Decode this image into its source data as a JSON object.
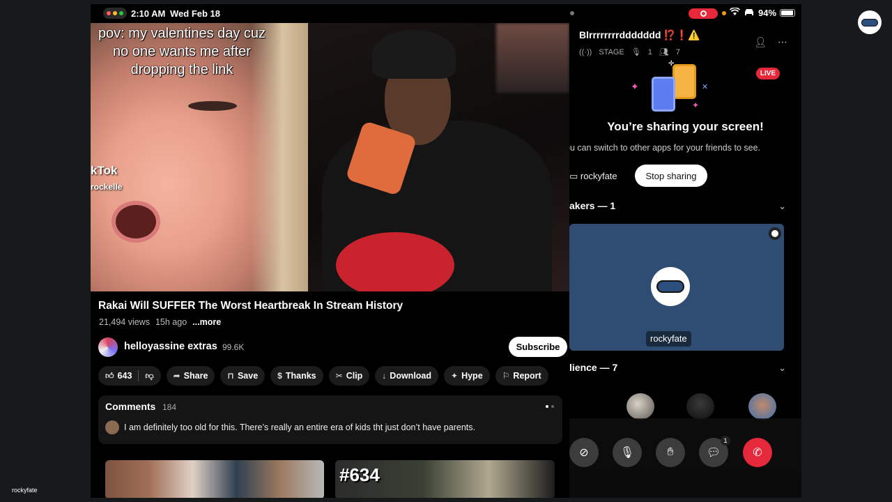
{
  "status_bar": {
    "time": "2:10 AM",
    "date": "Wed Feb 18",
    "battery": "94%",
    "dot_colors": [
      "#ff5f57",
      "#febc2e",
      "#28c840"
    ]
  },
  "video": {
    "overlay_caption": "pov: my valentines day cuz no one wants me after dropping the link",
    "tiktok_label": "kTok",
    "tiktok_user": "rockelle",
    "title": "Rakai Will SUFFER The Worst Heartbreak In Stream History",
    "views": "21,494 views",
    "age": "15h ago",
    "more": "...more"
  },
  "channel": {
    "name": "helloyassine extras",
    "subscribers": "99.6K",
    "subscribe_label": "Subscribe"
  },
  "actions": {
    "likes": "643",
    "share": "Share",
    "save": "Save",
    "thanks": "Thanks",
    "clip": "Clip",
    "download": "Download",
    "hype": "Hype",
    "report": "Report"
  },
  "comments": {
    "heading": "Comments",
    "count": "184",
    "top_comment": "I am definitely too old for this. There’s really an entire era of kids tht just don’t have parents."
  },
  "thumbnails": {
    "second_label": "#634"
  },
  "discord": {
    "title": "Blrrrrrrrrddddddd ⁉️❗⚠️",
    "stage_label": "STAGE",
    "speaker_count": "1",
    "listener_count": "7",
    "live_label": "LIVE",
    "share_title": "You’re sharing your screen!",
    "share_subtitle": "ou can switch to other apps for your friends to see.",
    "share_user": "rockyfate",
    "stop_label": "Stop sharing",
    "speakers_section": "akers — 1",
    "speaker_name": "rockyfate",
    "audience_section": "lience — 7",
    "chat_badge": "1",
    "accent_color": "#e5283a"
  },
  "footer": {
    "username": "rockyfate"
  }
}
